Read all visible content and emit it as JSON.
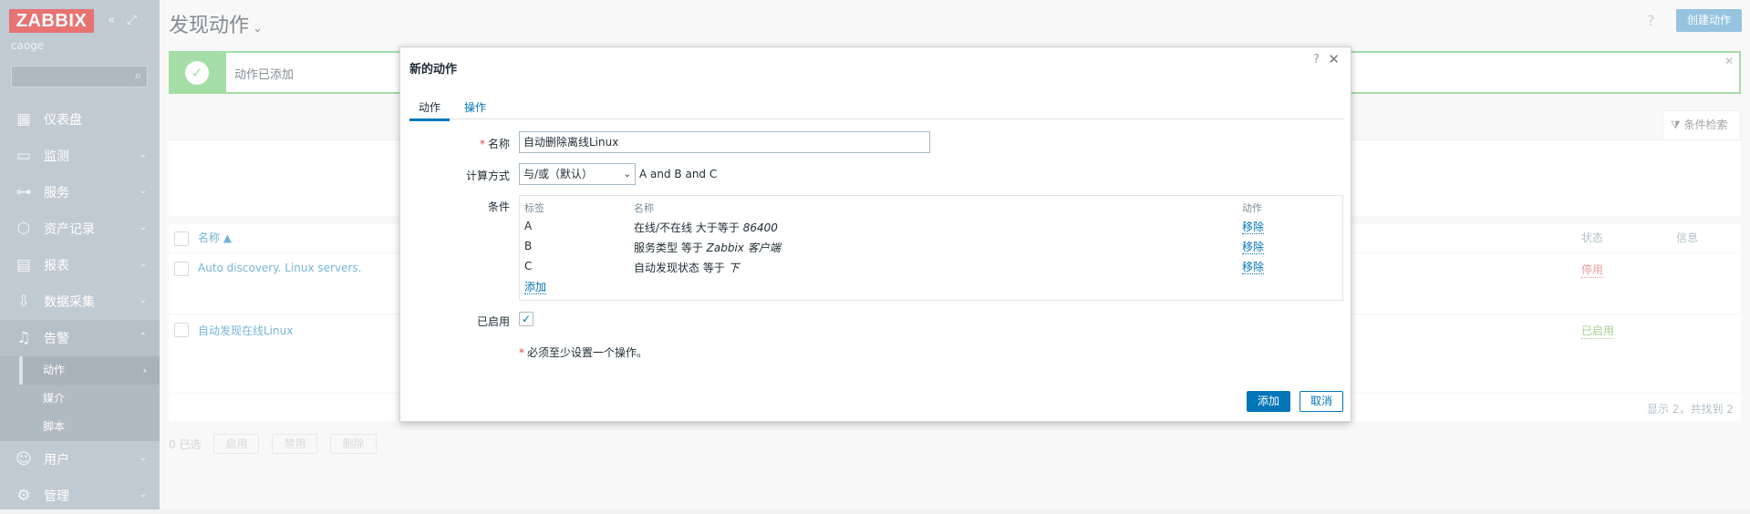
{
  "sidebar": {
    "logo": "ZABBIX",
    "collapse_icon": "collapse-icon",
    "kiosk_icon": "kiosk-icon",
    "user": "caoge",
    "search_placeholder": "",
    "items": [
      {
        "label": "仪表盘",
        "icon": "dashboard-icon"
      },
      {
        "label": "监测",
        "icon": "monitoring-icon"
      },
      {
        "label": "服务",
        "icon": "services-icon"
      },
      {
        "label": "资产记录",
        "icon": "inventory-icon"
      },
      {
        "label": "报表",
        "icon": "reports-icon"
      },
      {
        "label": "数据采集",
        "icon": "data-collection-icon"
      },
      {
        "label": "告警",
        "icon": "alerts-icon"
      },
      {
        "label": "用户",
        "icon": "users-icon"
      },
      {
        "label": "管理",
        "icon": "administration-icon"
      }
    ],
    "alerts_submenu": [
      {
        "label": "动作"
      },
      {
        "label": "媒介"
      },
      {
        "label": "脚本"
      }
    ]
  },
  "header": {
    "title": "发现动作",
    "create_button": "创建动作"
  },
  "banner": {
    "message": "动作已添加"
  },
  "filter": {
    "tab_label": "条件检索"
  },
  "table": {
    "columns": {
      "name": "名称 ▲",
      "status": "状态",
      "info": "信息"
    },
    "rows": [
      {
        "name": "Auto discovery. Linux servers.",
        "status": "停用"
      },
      {
        "name": "自动发现在线Linux",
        "status": "已启用"
      }
    ],
    "footer": "显示 2，共找到 2"
  },
  "bottom": {
    "selected": "0 已选",
    "enable": "启用",
    "disable": "禁用",
    "delete": "删除"
  },
  "dialog": {
    "title": "新的动作",
    "tabs": {
      "action": "动作",
      "operations": "操作"
    },
    "name_label": "名称",
    "name_value": "自动删除离线Linux",
    "calc_label": "计算方式",
    "calc_value": "与/或（默认）",
    "calc_formula": "A and B and C",
    "conditions_label": "条件",
    "conditions_headers": {
      "label": "标签",
      "name": "名称",
      "action": "动作"
    },
    "conditions": [
      {
        "label": "A",
        "name_prefix": "在线/不在线 大于等于 ",
        "name_value": "86400",
        "action": "移除"
      },
      {
        "label": "B",
        "name_prefix": "服务类型 等于 ",
        "name_value": "Zabbix 客户端",
        "action": "移除"
      },
      {
        "label": "C",
        "name_prefix": "自动发现状态 等于 ",
        "name_value": "下",
        "action": "移除"
      }
    ],
    "add_condition": "添加",
    "enabled_label": "已启用",
    "warning": "必须至少设置一个操作。",
    "add_button": "添加",
    "cancel_button": "取消"
  }
}
